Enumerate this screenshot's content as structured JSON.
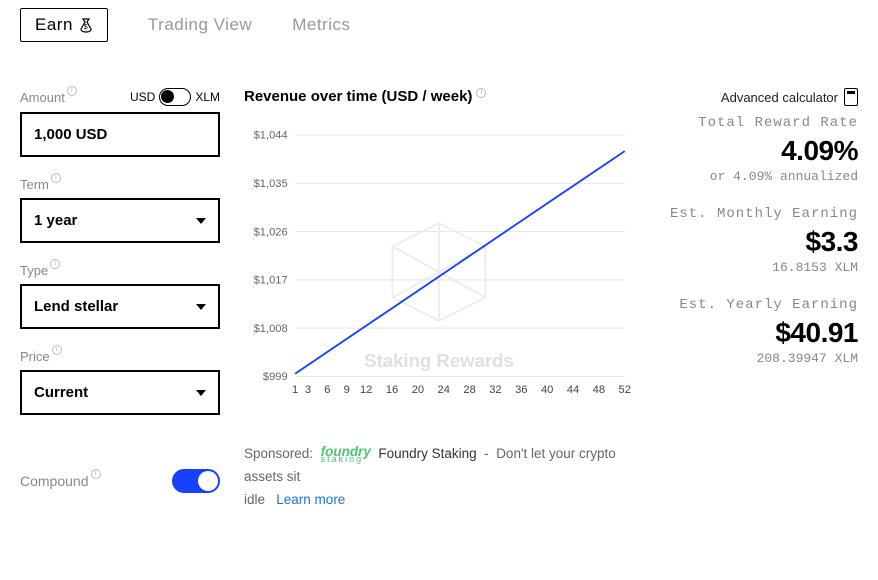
{
  "tabs": {
    "earn": "Earn",
    "trading": "Trading View",
    "metrics": "Metrics"
  },
  "left": {
    "amount_label": "Amount",
    "currency_left": "USD",
    "currency_right": "XLM",
    "amount_value": "1,000 USD",
    "term_label": "Term",
    "term_value": "1 year",
    "type_label": "Type",
    "type_value": "Lend stellar",
    "price_label": "Price",
    "price_value": "Current",
    "compound_label": "Compound"
  },
  "chart_data": {
    "type": "line",
    "title": "Revenue over time (USD / week)",
    "xlabel": "",
    "ylabel": "",
    "x": [
      1,
      3,
      6,
      9,
      12,
      16,
      20,
      24,
      28,
      32,
      36,
      40,
      44,
      48,
      52
    ],
    "y_ticks": [
      "$999",
      "$1,008",
      "$1,017",
      "$1,026",
      "$1,035",
      "$1,044"
    ],
    "ylim": [
      999,
      1044
    ],
    "xlim": [
      1,
      52
    ],
    "series": [
      {
        "name": "Revenue",
        "x": [
          1,
          52
        ],
        "values": [
          999.5,
          1041
        ]
      }
    ],
    "watermark": "Staking Rewards"
  },
  "right": {
    "advanced": "Advanced calculator",
    "trr_label": "Total Reward Rate",
    "trr_value": "4.09%",
    "trr_sub": "or 4.09% annualized",
    "monthly_label": "Est. Monthly Earning",
    "monthly_value": "$3.3",
    "monthly_sub": "16.8153 XLM",
    "yearly_label": "Est. Yearly Earning",
    "yearly_value": "$40.91",
    "yearly_sub": "208.39947 XLM"
  },
  "sponsor": {
    "label": "Sponsored:",
    "brand_top": "foundry",
    "brand_sub": "staking",
    "title": "Foundry Staking",
    "dash": "-",
    "desc1": "Don't let your crypto assets sit",
    "desc2": "idle",
    "learn": "Learn more"
  }
}
